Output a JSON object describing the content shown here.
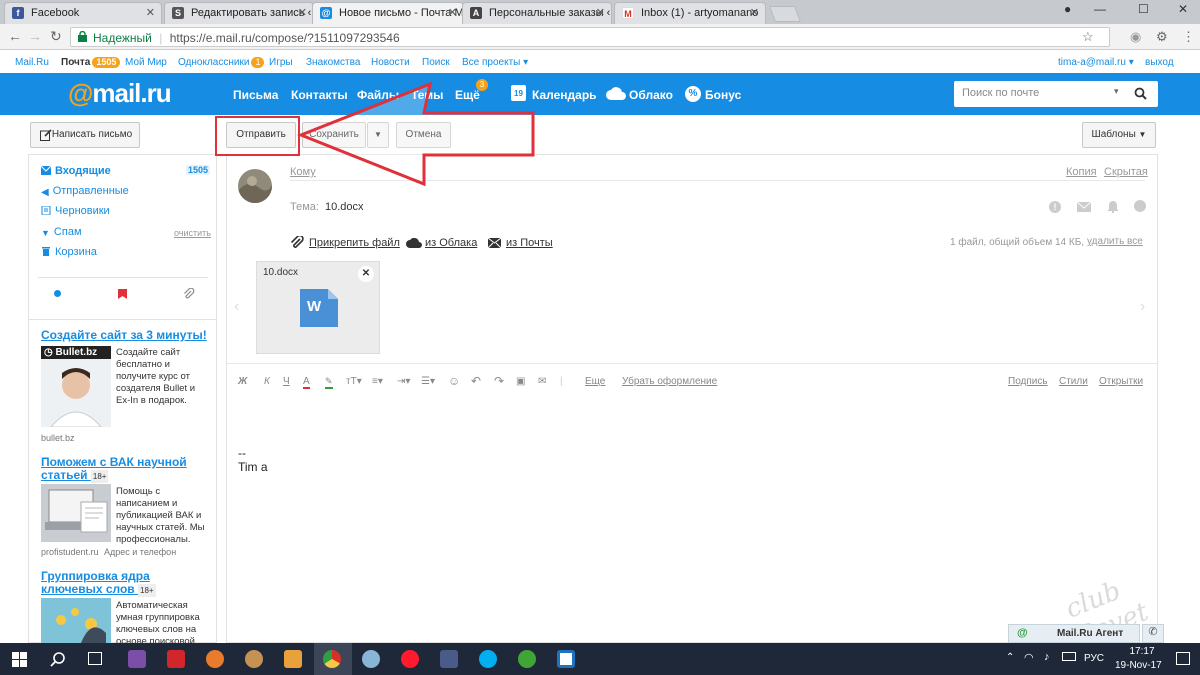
{
  "browser": {
    "tabs": [
      {
        "title": "Facebook",
        "favicon": "f",
        "color": "#3b5998"
      },
      {
        "title": "Редактировать запись ‹",
        "favicon": "S",
        "color": "#555555"
      },
      {
        "title": "Новое письмо - Почта М",
        "favicon": "@",
        "color": "#168de2"
      },
      {
        "title": "Персональные заказы ‹",
        "favicon": "A",
        "color": "#444444"
      },
      {
        "title": "Inbox (1) - artyomanano",
        "favicon": "M",
        "color": "#d93025"
      }
    ],
    "secure_label": "Надежный",
    "url": "https://e.mail.ru/compose/?1511097293546"
  },
  "portal": {
    "items": [
      "Mail.Ru",
      "Почта",
      "Мой Мир",
      "Одноклассники",
      "Игры",
      "Знакомства",
      "Новости",
      "Поиск",
      "Все проекты"
    ],
    "mail_badge": "1505",
    "ok_badge": "1",
    "user": "tima-a@mail.ru",
    "logout": "выход"
  },
  "header": {
    "logo_at": "@",
    "logo_text": "mail.ru",
    "nav": [
      "Письма",
      "Контакты",
      "Файлы",
      "Темы",
      "Ещё"
    ],
    "more_badge": "3",
    "calendar": "Календарь",
    "calendar_day": "19",
    "cloud": "Облако",
    "bonus": "Бонус",
    "search_placeholder": "Поиск по почте"
  },
  "toolbar": {
    "compose": "Написать письмо",
    "send": "Отправить",
    "save": "Сохранить",
    "cancel": "Отмена",
    "templates": "Шаблоны"
  },
  "sidebar": {
    "folders": [
      {
        "label": "Входящие",
        "count": "1505"
      },
      {
        "label": "Отправленные"
      },
      {
        "label": "Черновики"
      },
      {
        "label": "Спам",
        "action": "очистить"
      },
      {
        "label": "Корзина"
      }
    ],
    "ads": [
      {
        "title": "Создайте сайт за 3 минуты!",
        "brand": "Bullet.bz",
        "text": "Создайте сайт бесплатно и получите курс от создателя Bullet и Ex-In в подарок.",
        "source": "bullet.bz"
      },
      {
        "title": "Поможем с ВАК научной статьей",
        "age": "18+",
        "text": "Помощь с написанием и публикацией ВАК и научных статей. Мы профессионалы.",
        "source": "profistudent.ru",
        "extra": "Адрес и телефон"
      },
      {
        "title": "Группировка ядра ключевых слов",
        "age": "18+",
        "text": "Автоматическая умная группировка ключевых слов на основе поисковой"
      }
    ]
  },
  "compose": {
    "to_label": "Кому",
    "copy": "Копия",
    "hidden": "Скрытая",
    "subject_label": "Тема:",
    "subject": "10.docx",
    "attach_file": "Прикрепить файл",
    "from_cloud": "из Облака",
    "from_mail": "из Почты",
    "attach_info": "1 файл, общий объем 14 КБ,",
    "delete_all": "удалить все",
    "attachment_name": "10.docx",
    "word_letter": "W",
    "more_fmt": "Еще",
    "clear_fmt": "Убрать оформление",
    "signature": "Подпись",
    "styles": "Стили",
    "postcards": "Открытки",
    "body_dash": "--",
    "body_name": "Tim a"
  },
  "agent": {
    "label": "Mail.Ru Агент"
  },
  "watermark": "club Sovet",
  "taskbar": {
    "lang": "РУС",
    "time": "17:17",
    "date": "19-Nov-17"
  },
  "colors": {
    "accent": "#168de2",
    "highlight": "#e0303a",
    "orange": "#f7a21b"
  }
}
